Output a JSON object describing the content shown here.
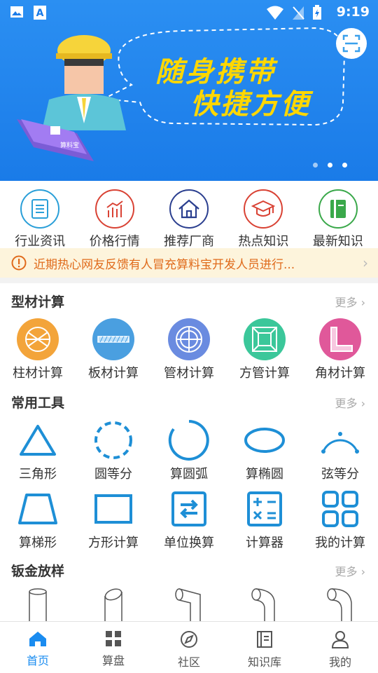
{
  "status_bar": {
    "time": "9:19"
  },
  "banner": {
    "slogan_line1": "随身携带",
    "slogan_line2": "快捷方便",
    "phone_caption": "算料宝"
  },
  "quick_nav": [
    {
      "label": "行业资讯",
      "color": "#2a9fd8"
    },
    {
      "label": "价格行情",
      "color": "#d94234"
    },
    {
      "label": "推荐厂商",
      "color": "#2b3f8f"
    },
    {
      "label": "热点知识",
      "color": "#d94234"
    },
    {
      "label": "最新知识",
      "color": "#3aa84a"
    }
  ],
  "notice": {
    "text": "近期热心网友反馈有人冒充算料宝开发人员进行..."
  },
  "sections": {
    "profile_calc": {
      "title": "型材计算",
      "more": "更多",
      "items": [
        {
          "label": "柱材计算",
          "color": "#f3a43a"
        },
        {
          "label": "板材计算",
          "color": "#4a9fe0"
        },
        {
          "label": "管材计算",
          "color": "#6a8be0"
        },
        {
          "label": "方管计算",
          "color": "#3bc79a"
        },
        {
          "label": "角材计算",
          "color": "#e0589a"
        }
      ]
    },
    "tools": {
      "title": "常用工具",
      "more": "更多",
      "items": [
        {
          "label": "三角形"
        },
        {
          "label": "圆等分"
        },
        {
          "label": "算圆弧"
        },
        {
          "label": "算椭圆"
        },
        {
          "label": "弦等分"
        },
        {
          "label": "算梯形"
        },
        {
          "label": "方形计算"
        },
        {
          "label": "单位换算"
        },
        {
          "label": "计算器"
        },
        {
          "label": "我的计算"
        }
      ]
    },
    "sheet_metal": {
      "title": "钣金放样",
      "more": "更多"
    }
  },
  "tabbar": [
    {
      "label": "首页",
      "active": true
    },
    {
      "label": "算盘",
      "active": false
    },
    {
      "label": "社区",
      "active": false
    },
    {
      "label": "知识库",
      "active": false
    },
    {
      "label": "我的",
      "active": false
    }
  ],
  "colors": {
    "accent": "#1a8cf0",
    "tool_icon": "#1e8fd6",
    "notice_text": "#e06b1c"
  }
}
